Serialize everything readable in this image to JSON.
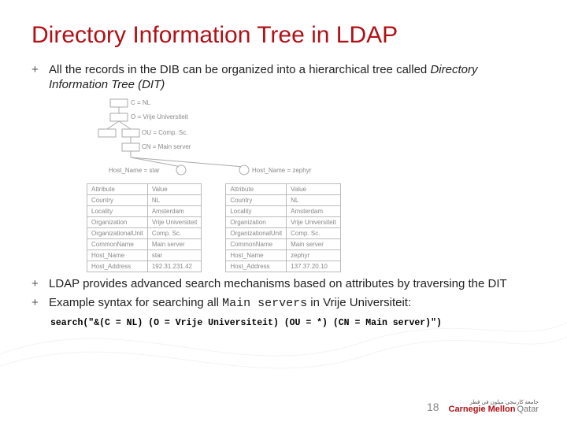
{
  "title": "Directory Information Tree in LDAP",
  "bullets": {
    "b1_pre": "All the records in the DIB can be organized into a hierarchical tree called ",
    "b1_em": "Directory Information Tree (DIT)",
    "b2": "LDAP provides advanced search mechanisms based on attributes by traversing the DIT",
    "b3_pre": "Example syntax for searching all ",
    "b3_code": "Main servers",
    "b3_post": " in Vrije Universiteit:"
  },
  "code_line": "search(\"&(C = NL) (O = Vrije Universiteit) (OU = *) (CN = Main server)\")",
  "tree_labels": {
    "c": "C = NL",
    "o": "O = Vrije Universiteit",
    "ou": "OU = Comp. Sc.",
    "cn": "CN = Main server",
    "h1": "Host_Name = star",
    "h2": "Host_Name = zephyr"
  },
  "tables": {
    "headers": [
      "Attribute",
      "Value"
    ],
    "left": [
      [
        "Country",
        "NL"
      ],
      [
        "Locality",
        "Amsterdam"
      ],
      [
        "Organization",
        "Vrije Universiteit"
      ],
      [
        "OrganizationalUnit",
        "Comp. Sc."
      ],
      [
        "CommonName",
        "Main server"
      ],
      [
        "Host_Name",
        "star"
      ],
      [
        "Host_Address",
        "192.31.231.42"
      ]
    ],
    "right": [
      [
        "Country",
        "NL"
      ],
      [
        "Locality",
        "Amsterdam"
      ],
      [
        "Organization",
        "Vrije Universiteit"
      ],
      [
        "OrganizationalUnit",
        "Comp. Sc."
      ],
      [
        "CommonName",
        "Main server"
      ],
      [
        "Host_Name",
        "zephyr"
      ],
      [
        "Host_Address",
        "137.37.20.10"
      ]
    ]
  },
  "page_number": "18",
  "logo": {
    "arabic": "جامعة كارنيجي ميلون في قطر",
    "name": "Carnegie Mellon",
    "loc": "Qatar"
  },
  "plus": "+"
}
